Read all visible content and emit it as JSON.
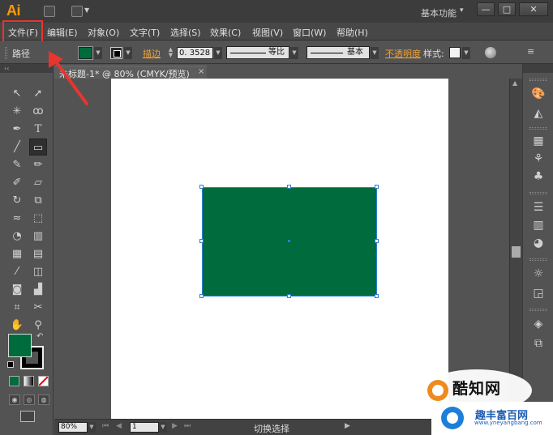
{
  "app": {
    "logo": "Ai",
    "workspace": "基本功能",
    "workspace_arrow": "▾"
  },
  "window_buttons": {
    "minimize": "—",
    "restore": "□",
    "close": "✕"
  },
  "menu": [
    "文件(F)",
    "编辑(E)",
    "对象(O)",
    "文字(T)",
    "选择(S)",
    "效果(C)",
    "视图(V)",
    "窗口(W)",
    "帮助(H)"
  ],
  "control_bar": {
    "selection_type": "路径",
    "stroke_label": "描边",
    "stroke_weight": "0. 3528",
    "profile_label": "等比",
    "brush_label": "基本",
    "opacity_label": "不透明度",
    "style_label": "样式:"
  },
  "colors": {
    "fill": "#006b3c",
    "selection": "#2a7fd4",
    "accent": "#f0a235",
    "annotation": "#e8352e"
  },
  "document": {
    "tab_title": "未标题-1* @ 80% (CMYK/预览)",
    "close": "×"
  },
  "status_bar": {
    "zoom": "80%",
    "page": "1",
    "tool_status": "切换选择"
  },
  "watermark": {
    "line1": "酷知网",
    "line2": "趣丰富百网",
    "url": "www.yneyangbang.com"
  }
}
